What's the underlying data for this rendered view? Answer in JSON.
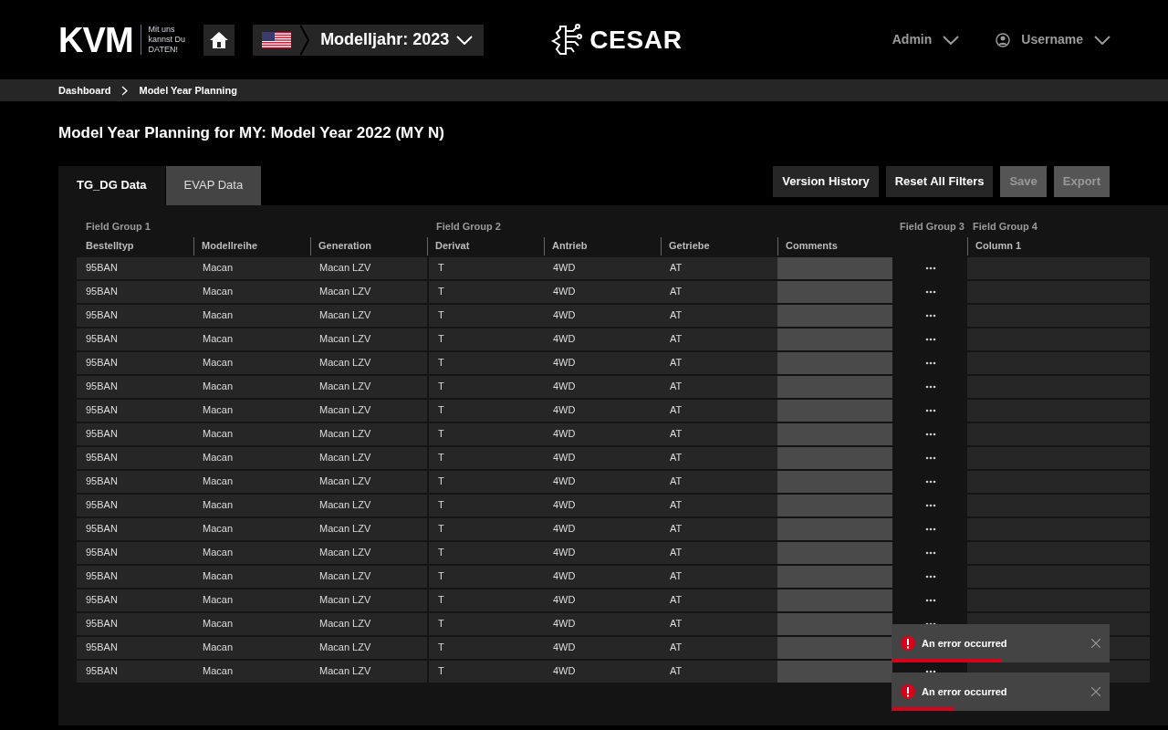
{
  "header": {
    "logo": "KVM",
    "slogan": [
      "Mit uns",
      "kannst Du",
      "DATEN!"
    ],
    "model_year": "Modelljahr: 2023",
    "app_name": "CESAR",
    "admin": "Admin",
    "user": "Username"
  },
  "breadcrumb": [
    "Dashboard",
    "Model Year Planning"
  ],
  "title": "Model Year Planning for MY: Model Year 2022 (MY N)",
  "tabs": [
    {
      "label": "TG_DG Data",
      "selected": true
    },
    {
      "label": "EVAP Data",
      "selected": false
    }
  ],
  "buttons": [
    {
      "label": "Version History",
      "disabled": false
    },
    {
      "label": "Reset All Filters",
      "disabled": false
    },
    {
      "label": "Save",
      "disabled": true
    },
    {
      "label": "Export",
      "disabled": true
    }
  ],
  "table": {
    "columns": [
      {
        "label": "Bestelltyp",
        "kind": "text",
        "group": "Field Group 1"
      },
      {
        "label": "Modellreihe",
        "kind": "text"
      },
      {
        "label": "Generation",
        "kind": "text"
      },
      {
        "label": "Derivat",
        "kind": "text",
        "group": "Field Group 2"
      },
      {
        "label": "Antrieb",
        "kind": "text"
      },
      {
        "label": "Getriebe",
        "kind": "text"
      },
      {
        "label": "Comments",
        "kind": "input"
      },
      {
        "kind": "menu",
        "group": "Field Group 3"
      },
      {
        "label": "Column 1",
        "kind": "text",
        "group": "Field Group 4"
      }
    ],
    "rows": [
      [
        "95BAN",
        "Macan",
        "Macan LZV",
        "T",
        "4WD",
        "AT"
      ],
      [
        "95BAN",
        "Macan",
        "Macan LZV",
        "T",
        "4WD",
        "AT"
      ],
      [
        "95BAN",
        "Macan",
        "Macan LZV",
        "T",
        "4WD",
        "AT"
      ],
      [
        "95BAN",
        "Macan",
        "Macan LZV",
        "T",
        "4WD",
        "AT"
      ],
      [
        "95BAN",
        "Macan",
        "Macan LZV",
        "T",
        "4WD",
        "AT"
      ],
      [
        "95BAN",
        "Macan",
        "Macan LZV",
        "T",
        "4WD",
        "AT"
      ],
      [
        "95BAN",
        "Macan",
        "Macan LZV",
        "T",
        "4WD",
        "AT"
      ],
      [
        "95BAN",
        "Macan",
        "Macan LZV",
        "T",
        "4WD",
        "AT"
      ],
      [
        "95BAN",
        "Macan",
        "Macan LZV",
        "T",
        "4WD",
        "AT"
      ],
      [
        "95BAN",
        "Macan",
        "Macan LZV",
        "T",
        "4WD",
        "AT"
      ],
      [
        "95BAN",
        "Macan",
        "Macan LZV",
        "T",
        "4WD",
        "AT"
      ],
      [
        "95BAN",
        "Macan",
        "Macan LZV",
        "T",
        "4WD",
        "AT"
      ],
      [
        "95BAN",
        "Macan",
        "Macan LZV",
        "T",
        "4WD",
        "AT"
      ],
      [
        "95BAN",
        "Macan",
        "Macan LZV",
        "T",
        "4WD",
        "AT"
      ],
      [
        "95BAN",
        "Macan",
        "Macan LZV",
        "T",
        "4WD",
        "AT"
      ],
      [
        "95BAN",
        "Macan",
        "Macan LZV",
        "T",
        "4WD",
        "AT"
      ],
      [
        "95BAN",
        "Macan",
        "Macan LZV",
        "T",
        "4WD",
        "AT"
      ],
      [
        "95BAN",
        "Macan",
        "Macan LZV",
        "T",
        "4WD",
        "AT"
      ]
    ]
  },
  "toasts": [
    {
      "message": "An error occurred",
      "level": 0.5
    },
    {
      "message": "An error occurred",
      "level": 0.29
    }
  ]
}
